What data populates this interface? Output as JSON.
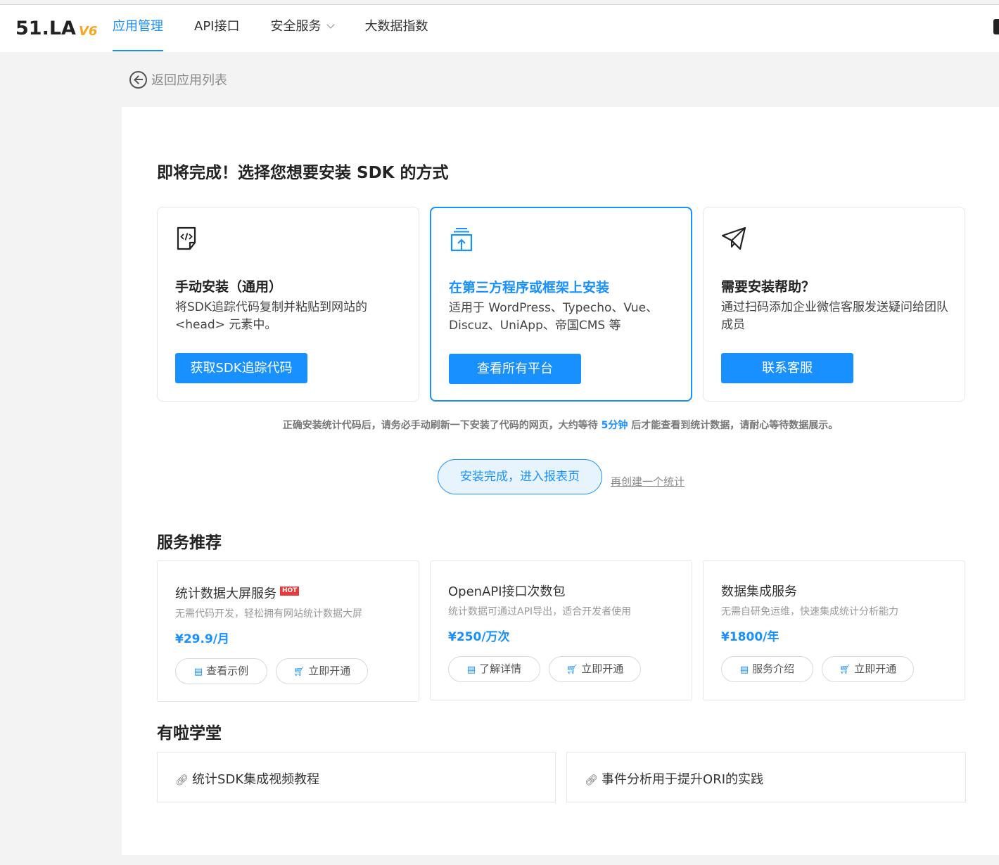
{
  "header": {
    "logo_main": "51.LA",
    "logo_version": "V6",
    "nav": [
      {
        "label": "应用管理",
        "active": true
      },
      {
        "label": "API接口",
        "active": false
      },
      {
        "label": "安全服务",
        "active": false,
        "dropdown": true
      },
      {
        "label": "大数据指数",
        "active": false
      }
    ]
  },
  "back_label": "返回应用列表",
  "install": {
    "title": "即将完成！选择您想要安装 SDK 的方式",
    "options": [
      {
        "icon": "code-file-icon",
        "title": "手动安装（通用）",
        "desc": "将SDK追踪代码复制并粘贴到网站的 <head> 元素中。",
        "button": "获取SDK追踪代码",
        "selected": false
      },
      {
        "icon": "upload-stack-icon",
        "title": "在第三方程序或框架上安装",
        "desc": "适用于 WordPress、Typecho、Vue、Discuz、UniApp、帝国CMS 等",
        "button": "查看所有平台",
        "selected": true
      },
      {
        "icon": "paper-plane-icon",
        "title": "需要安装帮助？",
        "desc": "通过扫码添加企业微信客服发送疑问给团队成员",
        "button": "联系客服",
        "selected": false
      }
    ],
    "notice_before": "正确安装统计代码后，请务必手动刷新一下安装了代码的网页，大约等待",
    "notice_highlight": "5分钟",
    "notice_after": "后才能查看到统计数据，请耐心等待数据展示。",
    "done_button": "安装完成，进入报表页",
    "create_again": "再创建一个统计"
  },
  "services": {
    "title": "服务推荐",
    "items": [
      {
        "name": "统计数据大屏服务",
        "hot": "HOT",
        "desc": "无需代码开发，轻松拥有网站统计数据大屏",
        "price": "¥29.9/月",
        "btn1": "查看示例",
        "btn2": "立即开通"
      },
      {
        "name": "OpenAPI接口次数包",
        "hot": "",
        "desc": "统计数据可通过API导出，适合开发者使用",
        "price": "¥250/万次",
        "btn1": "了解详情",
        "btn2": "立即开通"
      },
      {
        "name": "数据集成服务",
        "hot": "",
        "desc": "无需自研免运维，快速集成统计分析能力",
        "price": "¥1800/年",
        "btn1": "服务介绍",
        "btn2": "立即开通"
      }
    ]
  },
  "academy": {
    "title": "有啦学堂",
    "links": [
      {
        "label": "统计SDK集成视频教程"
      },
      {
        "label": "事件分析用于提升ORI的实践"
      }
    ]
  },
  "colors": {
    "accent": "#1890ff",
    "hot": "#e83a3a",
    "logo_version": "#f5a623"
  }
}
